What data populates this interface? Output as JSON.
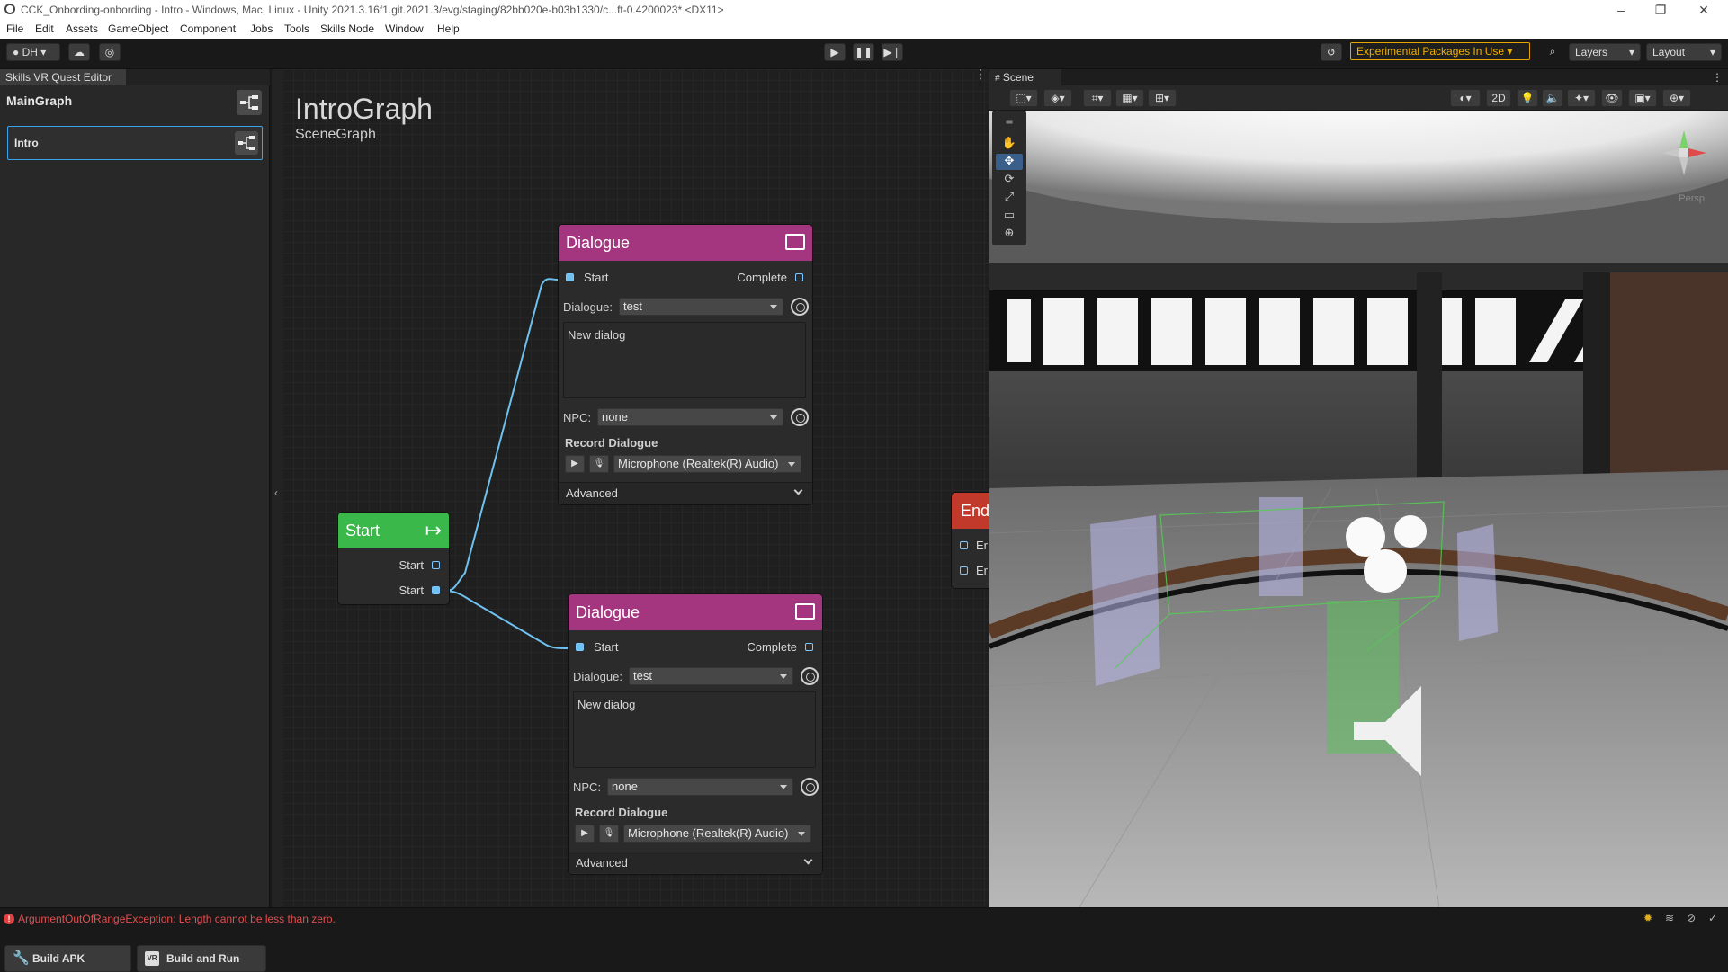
{
  "window": {
    "title": "CCK_Onbording-onbording - Intro - Windows, Mac, Linux - Unity 2021.3.16f1.git.2021.3/evg/staging/82bb020e-b03b1330/c...ft-0.4200023* <DX11>"
  },
  "menu": [
    "File",
    "Edit",
    "Assets",
    "GameObject",
    "Component",
    "Jobs",
    "Tools",
    "Skills Node",
    "Window",
    "Help"
  ],
  "toolbar": {
    "account": "DH",
    "experimental": "Experimental Packages In Use",
    "layers": "Layers",
    "layout": "Layout"
  },
  "left_panel": {
    "tab": "Skills VR Quest Editor",
    "graph_title": "MainGraph",
    "selected_item": "Intro",
    "build_apk": "Build APK",
    "build_and_run": "Build and Run",
    "vr_badge": "VR"
  },
  "graph": {
    "title": "IntroGraph",
    "subtitle": "SceneGraph",
    "start_node": {
      "header": "Start",
      "ports": [
        "Start",
        "Start"
      ],
      "colors": {
        "header": "#3bb84a"
      }
    },
    "dialogue_nodes": [
      {
        "header": "Dialogue",
        "in_port": "Start",
        "out_port": "Complete",
        "dialogue_label": "Dialogue:",
        "dialogue_value": "test",
        "text": "New dialog",
        "npc_label": "NPC:",
        "npc_value": "none",
        "record_label": "Record Dialogue",
        "mic": "Microphone (Realtek(R) Audio)",
        "advanced": "Advanced"
      },
      {
        "header": "Dialogue",
        "in_port": "Start",
        "out_port": "Complete",
        "dialogue_label": "Dialogue:",
        "dialogue_value": "test",
        "text": "New dialog",
        "npc_label": "NPC:",
        "npc_value": "none",
        "record_label": "Record Dialogue",
        "mic": "Microphone (Realtek(R) Audio)",
        "advanced": "Advanced"
      }
    ],
    "end_node": {
      "header": "End",
      "ports": [
        "Er",
        "Er"
      ]
    },
    "colors": {
      "dialogue_header": "#a3367f",
      "end_header": "#c0392b",
      "edge": "#6fc2f0"
    }
  },
  "scene": {
    "tab": "Scene",
    "mode_2d": "2D",
    "persp": "Persp"
  },
  "status": {
    "message": "ArgumentOutOfRangeException: Length cannot be less than zero."
  }
}
